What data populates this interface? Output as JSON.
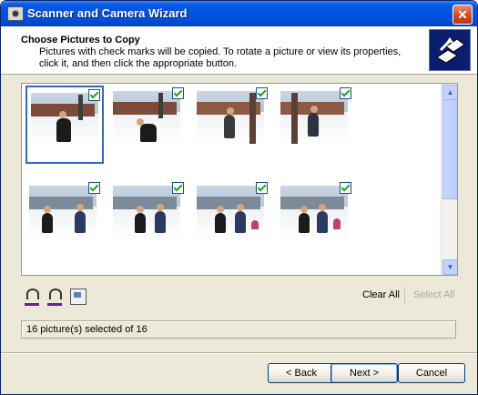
{
  "window": {
    "title": "Scanner and Camera Wizard",
    "close_glyph": "✕"
  },
  "header": {
    "title": "Choose Pictures to Copy",
    "description": "Pictures with check marks will be copied. To rotate a picture or view its properties, click it, and then click the appropriate button.",
    "logo_icon": "wizard-logo-icon"
  },
  "photos": {
    "items": [
      {
        "checked": true,
        "selected": true
      },
      {
        "checked": true,
        "selected": false
      },
      {
        "checked": true,
        "selected": false
      },
      {
        "checked": true,
        "selected": false
      },
      {
        "checked": true,
        "selected": false
      },
      {
        "checked": true,
        "selected": false
      },
      {
        "checked": true,
        "selected": false
      },
      {
        "checked": true,
        "selected": false
      }
    ]
  },
  "scrollbar": {
    "up_glyph": "▲",
    "down_glyph": "▼"
  },
  "toolbar": {
    "rotate_left_icon": "rotate-left-icon",
    "rotate_right_icon": "rotate-right-icon",
    "properties_icon": "properties-icon",
    "clear_all": "Clear All",
    "select_all": "Select All"
  },
  "status": {
    "text": "16 picture(s) selected of 16"
  },
  "buttons": {
    "back": "< Back",
    "next": "Next >",
    "cancel": "Cancel"
  },
  "colors": {
    "title_bar": "#0054e3",
    "selection": "#316ac5",
    "check": "#21a121"
  }
}
